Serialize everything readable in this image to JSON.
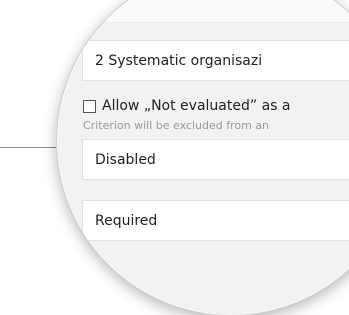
{
  "fields": {
    "organisation_value": "2 Systematic organisazi",
    "disabled_value": "Disabled",
    "required_value": "Required"
  },
  "checkbox": {
    "label": "Allow „Not evaluated” as a",
    "hint": "Criterion will be excluded from an",
    "checked": false
  }
}
